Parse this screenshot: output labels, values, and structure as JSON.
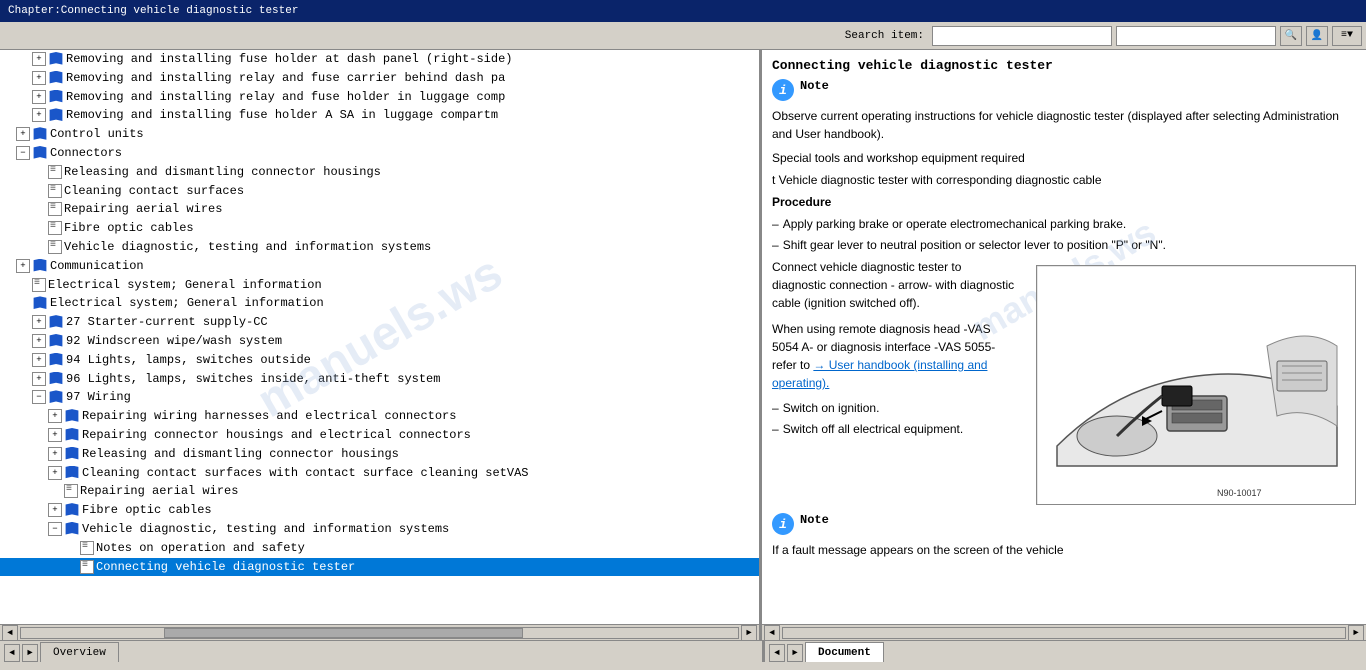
{
  "titlebar": {
    "text": "Chapter:Connecting vehicle diagnostic tester"
  },
  "toolbar": {
    "search_label": "Search item:",
    "search_placeholder": ""
  },
  "left_panel": {
    "tree_items": [
      {
        "id": 1,
        "indent": 2,
        "type": "book",
        "expand": "+",
        "text": "Removing and installing fuse holder at dash panel (right-side)",
        "has_expand": true
      },
      {
        "id": 2,
        "indent": 2,
        "type": "book",
        "expand": "+",
        "text": "Removing and installing relay and fuse carrier behind dash pa",
        "has_expand": true
      },
      {
        "id": 3,
        "indent": 2,
        "type": "book",
        "expand": "+",
        "text": "Removing and installing relay and fuse holder in luggage comp",
        "has_expand": true
      },
      {
        "id": 4,
        "indent": 2,
        "type": "book",
        "expand": "+",
        "text": "Removing and installing fuse holder A SA in luggage compartm",
        "has_expand": true
      },
      {
        "id": 5,
        "indent": 1,
        "type": "book",
        "expand": "+",
        "text": "Control units",
        "has_expand": true
      },
      {
        "id": 6,
        "indent": 1,
        "type": "book",
        "expand": "-",
        "text": "Connectors",
        "has_expand": true
      },
      {
        "id": 7,
        "indent": 2,
        "type": "page",
        "text": "Releasing and dismantling connector housings"
      },
      {
        "id": 8,
        "indent": 2,
        "type": "page",
        "text": "Cleaning contact surfaces"
      },
      {
        "id": 9,
        "indent": 2,
        "type": "page",
        "text": "Repairing aerial wires"
      },
      {
        "id": 10,
        "indent": 2,
        "type": "page",
        "text": "Fibre optic cables"
      },
      {
        "id": 11,
        "indent": 2,
        "type": "page",
        "text": "Vehicle diagnostic, testing and information systems"
      },
      {
        "id": 12,
        "indent": 1,
        "type": "book",
        "expand": "+",
        "text": "Communication",
        "has_expand": true
      },
      {
        "id": 13,
        "indent": 1,
        "type": "page",
        "text": "Electrical system; General information"
      },
      {
        "id": 14,
        "indent": 1,
        "type": "book",
        "expand": "-",
        "text": "Electrical system; General information",
        "special": "open"
      },
      {
        "id": 15,
        "indent": 2,
        "type": "book",
        "expand": "+",
        "text": "27 Starter-current supply-CC",
        "has_expand": true
      },
      {
        "id": 16,
        "indent": 2,
        "type": "book",
        "expand": "+",
        "text": "92 Windscreen wipe/wash system",
        "has_expand": true
      },
      {
        "id": 17,
        "indent": 2,
        "type": "book",
        "expand": "+",
        "text": "94 Lights, lamps, switches outside",
        "has_expand": true
      },
      {
        "id": 18,
        "indent": 2,
        "type": "book",
        "expand": "+",
        "text": "96 Lights, lamps, switches inside, anti-theft system",
        "has_expand": true
      },
      {
        "id": 19,
        "indent": 2,
        "type": "book",
        "expand": "-",
        "text": "97 Wiring",
        "has_expand": true
      },
      {
        "id": 20,
        "indent": 3,
        "type": "book",
        "expand": "+",
        "text": "Repairing wiring harnesses and electrical connectors",
        "has_expand": true
      },
      {
        "id": 21,
        "indent": 3,
        "type": "book",
        "expand": "+",
        "text": "Repairing connector housings and electrical connectors",
        "has_expand": true
      },
      {
        "id": 22,
        "indent": 3,
        "type": "book",
        "expand": "+",
        "text": "Releasing and dismantling connector housings",
        "has_expand": true
      },
      {
        "id": 23,
        "indent": 3,
        "type": "book",
        "expand": "+",
        "text": "Cleaning contact surfaces with contact surface cleaning setVAS",
        "has_expand": true
      },
      {
        "id": 24,
        "indent": 3,
        "type": "page",
        "text": "Repairing aerial wires"
      },
      {
        "id": 25,
        "indent": 3,
        "type": "book",
        "expand": "+",
        "text": "Fibre optic cables",
        "has_expand": true
      },
      {
        "id": 26,
        "indent": 3,
        "type": "book",
        "expand": "-",
        "text": "Vehicle diagnostic, testing and information systems",
        "has_expand": true
      },
      {
        "id": 27,
        "indent": 4,
        "type": "page",
        "text": "Notes on operation and safety"
      },
      {
        "id": 28,
        "indent": 4,
        "type": "page",
        "text": "Connecting vehicle diagnostic tester",
        "active": true
      }
    ]
  },
  "right_panel": {
    "title": "Connecting vehicle diagnostic tester",
    "note_label": "Note",
    "note_text": "Observe current operating instructions for vehicle diagnostic tester (displayed after selecting Administration and User handbook).",
    "special_tools_label": "Special tools and workshop equipment required",
    "tool_item": "t  Vehicle diagnostic tester with corresponding diagnostic cable",
    "procedure_label": "Procedure",
    "steps": [
      "Apply parking brake or operate electromechanical parking brake.",
      "Shift gear lever to neutral position or selector lever to position \"P\" or \"N\"."
    ],
    "connect_text": "Connect vehicle diagnostic tester to diagnostic connection - arrow- with diagnostic cable (ignition switched off).",
    "remote_text": "When using remote diagnosis head -VAS 5054 A- or diagnosis interface -VAS 5055- refer to",
    "remote_link": "→ User handbook (installing and operating).",
    "switch_on": "Switch on ignition.",
    "switch_off": "Switch off all electrical equipment.",
    "note2_label": "Note",
    "note2_text": "If a fault message appears on the screen of the vehicle",
    "diagram_label": "N90-10017",
    "arrow_diagnostic_text": "arrow - With diagnostic"
  },
  "bottom_tabs": {
    "left": [
      {
        "label": "Overview",
        "active": false
      },
      {
        "label": "",
        "separator": true
      }
    ],
    "right": [
      {
        "label": "Document",
        "active": true
      }
    ]
  },
  "icons": {
    "expand_plus": "+",
    "expand_minus": "−",
    "arrow_left": "◄",
    "arrow_right": "►",
    "search_icon": "🔍",
    "user_icon": "👤"
  }
}
